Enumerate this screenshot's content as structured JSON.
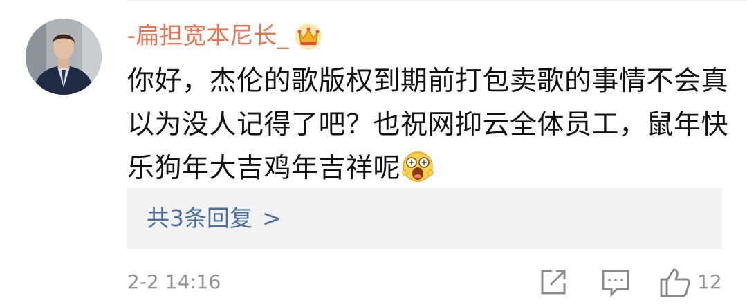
{
  "comment": {
    "username": "-扁担宽本尼长_",
    "badge_icon": "crown-icon",
    "text_lines": [
      "你好，杰伦的歌版权到期前打包卖歌的事情不会真",
      "以为没人记得了吧？也祝网抑云全体员工，鼠年快",
      "乐狗年大吉鸡年吉祥呢"
    ],
    "trailing_emoji": "surprised-face-emoji",
    "replies_label": "共3条回复",
    "replies_arrow": ">",
    "timestamp": "2-2 14:16",
    "like_count": "12"
  },
  "icons": {
    "share": "share-icon",
    "reply": "comment-icon",
    "like": "thumbs-up-icon"
  },
  "colors": {
    "username": "#eb7350",
    "link": "#4a6f9e",
    "meta": "#939393",
    "reply_bg": "#f2f2f2"
  }
}
